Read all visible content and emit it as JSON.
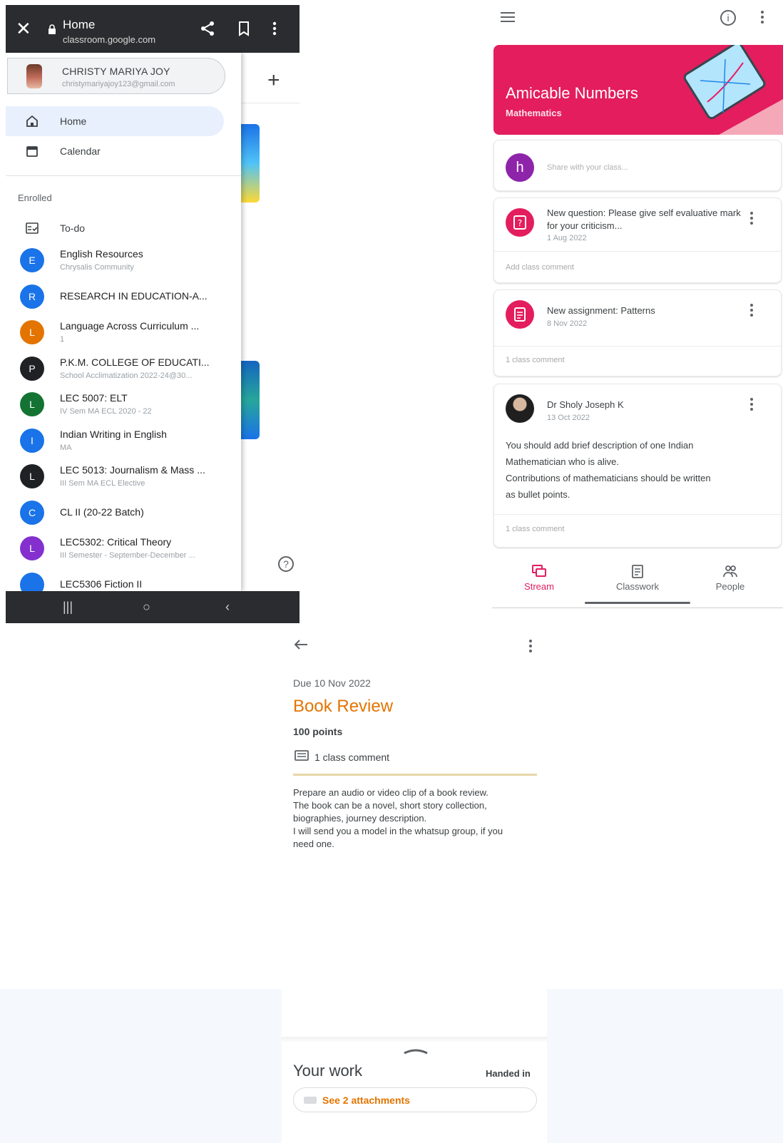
{
  "browser": {
    "page_title": "Home",
    "url": "classroom.google.com",
    "icons": [
      "close-icon",
      "lock-icon",
      "share-icon",
      "bookmark-icon",
      "more-vert-icon"
    ]
  },
  "drawer": {
    "account_name": "CHRISTY MARIYA JOY",
    "account_email": "christymariyajoy123@gmail.com",
    "nav": [
      {
        "label": "Home",
        "icon": "home-icon",
        "selected": true
      },
      {
        "label": "Calendar",
        "icon": "calendar-icon",
        "selected": false
      }
    ],
    "section_label": "Enrolled",
    "todo_label": "To-do",
    "courses": [
      {
        "initial": "E",
        "name": "English Resources",
        "subtitle": "Chrysalis Community",
        "color": "#1a73e8"
      },
      {
        "initial": "R",
        "name": "RESEARCH IN EDUCATION-A...",
        "subtitle": "",
        "color": "#1a73e8"
      },
      {
        "initial": "L",
        "name": "Language Across Curriculum ...",
        "subtitle": "1",
        "color": "#e37400"
      },
      {
        "initial": "P",
        "name": "P.K.M. COLLEGE OF EDUCATI...",
        "subtitle": "School Acclimatization 2022-24@30...",
        "color": "#202124"
      },
      {
        "initial": "L",
        "name": "LEC 5007: ELT",
        "subtitle": "IV Sem MA ECL 2020 - 22",
        "color": "#137333"
      },
      {
        "initial": "I",
        "name": "Indian Writing in English",
        "subtitle": "MA",
        "color": "#1a73e8"
      },
      {
        "initial": "L",
        "name": "LEC 5013: Journalism & Mass ...",
        "subtitle": "III Sem MA ECL Elective",
        "color": "#202124"
      },
      {
        "initial": "C",
        "name": "CL II (20-22 Batch)",
        "subtitle": "",
        "color": "#1a73e8"
      },
      {
        "initial": "L",
        "name": "LEC5302: Critical Theory",
        "subtitle": "III Semester - September-December ...",
        "color": "#8430ce"
      },
      {
        "initial": "",
        "name": "LEC5306 Fiction II",
        "subtitle": "",
        "color": "#1a73e8"
      }
    ],
    "help_glyph": "?"
  },
  "stream": {
    "class_title": "Amicable Numbers",
    "class_subtitle": "Mathematics",
    "banner_color": "#e31d5e",
    "avatar_initial": "h",
    "share_placeholder": "Share with your class...",
    "posts": [
      {
        "type": "question",
        "title": "New question: Please give self evaluative mark for your criticism...",
        "date": "1 Aug 2022",
        "footer": "Add class comment"
      },
      {
        "type": "assignment",
        "title": "New assignment: Patterns",
        "date": "8 Nov 2022",
        "footer": "1 class comment"
      },
      {
        "type": "announcement",
        "author": "Dr Sholy Joseph K",
        "date": "13 Oct 2022",
        "body": [
          "You should add brief description of one Indian",
          "Mathematician who is alive.",
          "Contributions of mathematicians should be written",
          "as bullet points."
        ],
        "footer": "1 class comment"
      }
    ],
    "tabs": [
      {
        "label": "Stream",
        "icon": "stream-icon",
        "active": true
      },
      {
        "label": "Classwork",
        "icon": "classwork-icon",
        "active": false
      },
      {
        "label": "People",
        "icon": "people-icon",
        "active": false
      }
    ],
    "accent": "#e31d5e"
  },
  "assignment": {
    "due": "Due 10 Nov 2022",
    "title": "Book Review",
    "points": "100 points",
    "comments": "1 class comment",
    "description": [
      "Prepare an audio or video clip of a book review.",
      "The book can be a novel, short story collection,",
      "biographies, journey description.",
      "I will send you a model in the whatsup group, if you",
      "need one."
    ],
    "your_work": "Your work",
    "status": "Handed in",
    "attachments": "See 2 attachments",
    "accent": "#e37400"
  }
}
